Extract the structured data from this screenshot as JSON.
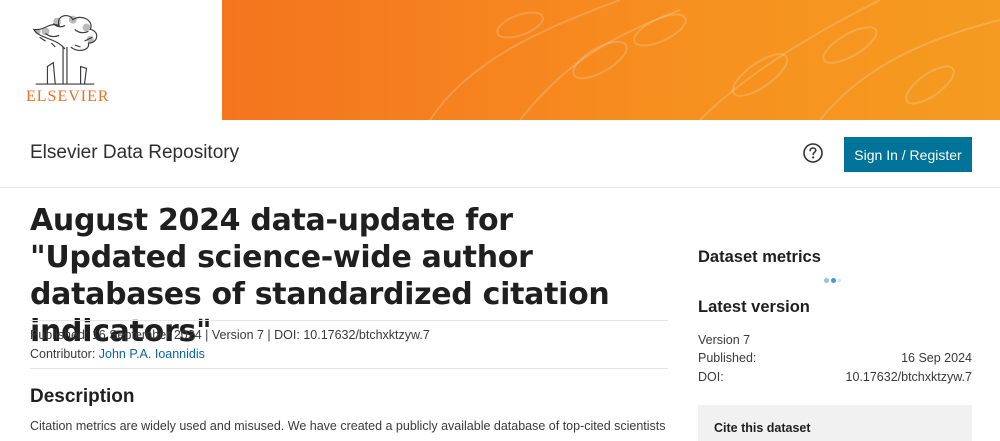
{
  "banner": {
    "logo_text": "ELSEVIER",
    "brand_color": "#f26c21"
  },
  "header": {
    "repo_title": "Elsevier Data Repository",
    "help_icon": "question-circle-icon",
    "signin_label": "Sign In / Register",
    "accent_color": "#007398"
  },
  "dataset": {
    "title": "August 2024 data-update for \"Updated science-wide author databases of standardized citation indicators\"",
    "published_line": "Published: 16 September 2024 | Version 7 | DOI: 10.17632/btchxktzyw.7",
    "contributor_label": "Contributor: ",
    "contributor_name": "John P.A. Ioannidis",
    "description_heading": "Description",
    "description_text": "Citation metrics are widely used and misused. We have created a publicly available database of top-cited scientists"
  },
  "sidebar": {
    "metrics_heading": "Dataset metrics",
    "latest_heading": "Latest version",
    "version_label": "Version 7",
    "published_label": "Published:",
    "published_value": "16 Sep 2024",
    "doi_label": "DOI:",
    "doi_value": "10.17632/btchxktzyw.7",
    "cite_label": "Cite this dataset"
  }
}
